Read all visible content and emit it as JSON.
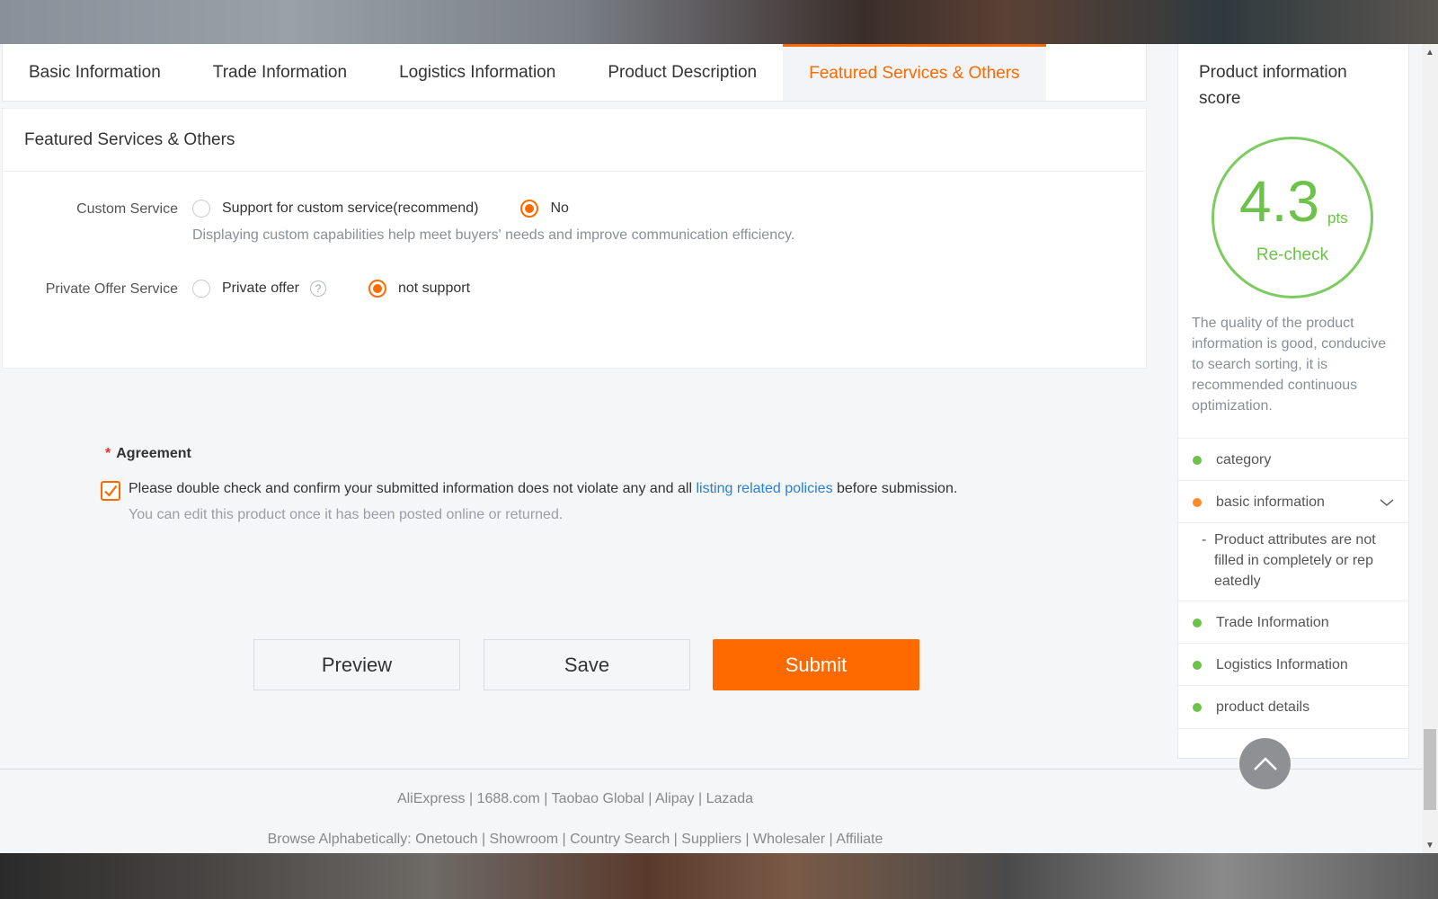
{
  "tabs": [
    "Basic Information",
    "Trade Information",
    "Logistics Information",
    "Product Description",
    "Featured Services & Others"
  ],
  "active_tab": "Featured Services & Others",
  "section_title": "Featured Services & Others",
  "custom_service": {
    "label": "Custom Service",
    "option_yes": "Support for custom service(recommend)",
    "option_no": "No",
    "selected": "No",
    "hint": "Displaying custom capabilities help meet buyers' needs and improve communication efficiency."
  },
  "private_offer": {
    "label": "Private Offer Service",
    "option_yes": "Private offer",
    "help": "?",
    "option_no": "not support",
    "selected": "not support"
  },
  "agreement": {
    "title": "Agreement",
    "required_mark": "*",
    "checked": true,
    "text_before": "Please double check and confirm your submitted information does not violate any and all ",
    "link": "listing related policies",
    "text_after": " before submission.",
    "note": "You can edit this product once it has been posted online or returned."
  },
  "buttons": {
    "preview": "Preview",
    "save": "Save",
    "submit": "Submit"
  },
  "footer": {
    "line1": "AliExpress | 1688.com | Taobao Global | Alipay | Lazada",
    "line2": "Browse Alphabetically: Onetouch | Showroom | Country Search | Suppliers | Wholesaler | Affiliate"
  },
  "score_panel": {
    "title": "Product information score",
    "score": "4.3",
    "unit": "pts",
    "recheck": "Re-check",
    "description": "The quality of the product information is good, conducive to search sorting, it is recommended continuous optimization.",
    "items": [
      {
        "label": "category",
        "status": "#6cc24a"
      },
      {
        "label": "basic information",
        "status": "#ff8a2a"
      },
      {
        "label": "Trade Information",
        "status": "#6cc24a"
      },
      {
        "label": "Logistics Information",
        "status": "#6cc24a"
      },
      {
        "label": "product details",
        "status": "#6cc24a"
      }
    ],
    "basic_info_issue": "Product attributes are not filled in completely or rep eatedly"
  },
  "colors": {
    "accent": "#ff6a00",
    "good": "#6cc24a",
    "link": "#2a7fd4"
  }
}
